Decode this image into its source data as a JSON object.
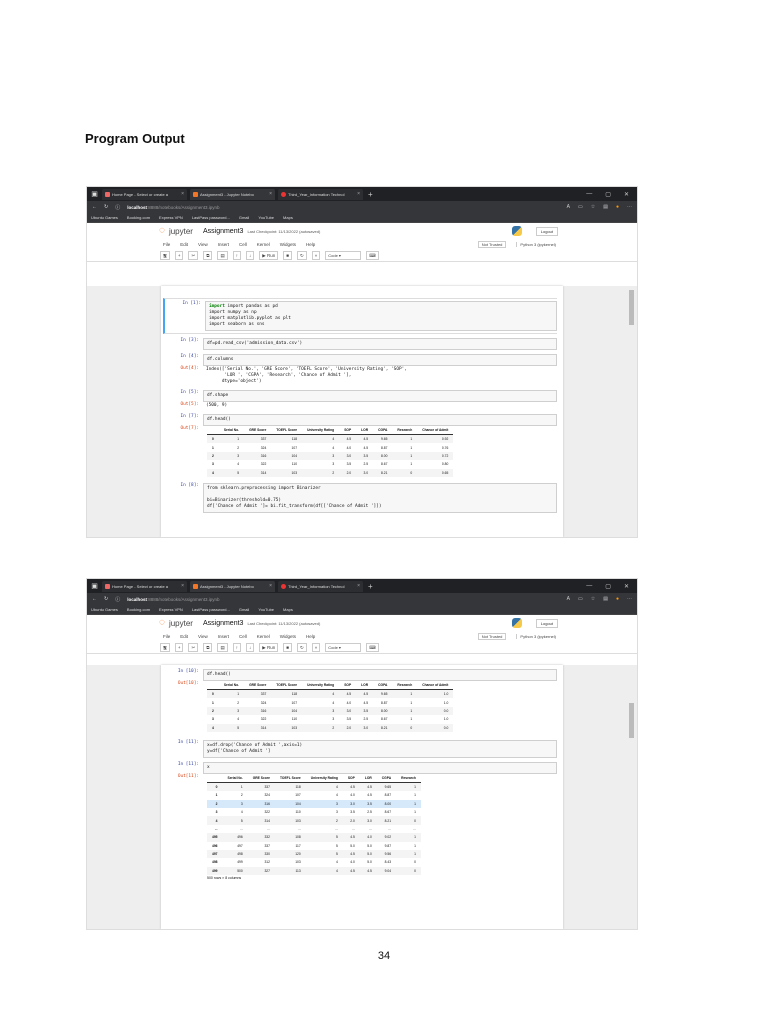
{
  "page": {
    "heading": "Program  Output",
    "page_number": "34"
  },
  "browser": {
    "tabs": [
      {
        "label": "Home Page - Select or create a"
      },
      {
        "label": "Assignment3 - Jupyter Notebo"
      },
      {
        "label": "Third_Year_Information Technol"
      }
    ],
    "url_host": "localhost",
    "url_path": ":8888/notebooks/Assignment3.ipynb",
    "bookmarks": [
      "Ubuntu Games",
      "Booking.com",
      "Express VPN",
      "LastPass password...",
      "Gmail",
      "YouTube",
      "Maps"
    ]
  },
  "jupyter": {
    "brand": "jupyter",
    "notebook_name": "Assignment3",
    "checkpoint": "Last Checkpoint: 11/13/2022  (autosaved)",
    "logout": "Logout",
    "menu": [
      "File",
      "Edit",
      "View",
      "Insert",
      "Cell",
      "Kernel",
      "Widgets",
      "Help"
    ],
    "not_trusted": "Not Trusted",
    "kernel": "Python 3 (ipykernel)",
    "cell_type": "Code",
    "toolbar_run": "Run"
  },
  "screen1": {
    "cells": [
      {
        "prompt": "In [1]:",
        "lines": [
          "import pandas as pd",
          "import numpy as np",
          "import matplotlib.pyplot as plt",
          "import seaborn as sns"
        ]
      },
      {
        "prompt": "In [3]:",
        "lines": [
          "df=pd.read_csv('admission_data.csv')"
        ]
      },
      {
        "prompt": "In [4]:",
        "lines": [
          "df.columns"
        ]
      },
      {
        "prompt": "Out[4]:",
        "lines": [
          "Index(['Serial No.', 'GRE Score', 'TOEFL Score', 'University Rating', 'SOP',",
          "       'LOR ', 'CGPA', 'Research', 'Chance of Admit '],",
          "      dtype='object')"
        ]
      },
      {
        "prompt": "In [5]:",
        "lines": [
          "df.shape"
        ]
      },
      {
        "prompt": "Out[5]:",
        "lines": [
          "(500, 9)"
        ]
      },
      {
        "prompt": "In [7]:",
        "lines": [
          "df.head()"
        ]
      },
      {
        "prompt": "Out[7]:"
      },
      {
        "prompt": "In [8]:",
        "lines": [
          "from sklearn.preprocessing import Binarizer",
          "",
          "bi=Binarizer(threshold=0.75)",
          "df['Chance of Admit ']= bi.fit_transform(df[['Chance of Admit ']])"
        ]
      }
    ],
    "head_table": {
      "columns": [
        "",
        "Serial No.",
        "GRE Score",
        "TOEFL Score",
        "University Rating",
        "SOP",
        "LOR",
        "CGPA",
        "Research",
        "Chance of Admit"
      ],
      "rows": [
        [
          "0",
          "1",
          "337",
          "118",
          "4",
          "4.5",
          "4.5",
          "9.65",
          "1",
          "0.92"
        ],
        [
          "1",
          "2",
          "324",
          "107",
          "4",
          "4.0",
          "4.5",
          "8.87",
          "1",
          "0.76"
        ],
        [
          "2",
          "3",
          "316",
          "104",
          "3",
          "3.0",
          "3.5",
          "8.00",
          "1",
          "0.72"
        ],
        [
          "3",
          "4",
          "322",
          "110",
          "3",
          "3.5",
          "2.5",
          "8.67",
          "1",
          "0.80"
        ],
        [
          "4",
          "5",
          "314",
          "103",
          "2",
          "2.0",
          "3.0",
          "8.21",
          "0",
          "0.65"
        ]
      ]
    }
  },
  "screen2": {
    "cells": [
      {
        "prompt": "In [10]:",
        "lines": [
          "df.head()"
        ]
      },
      {
        "prompt": "Out[10]:"
      },
      {
        "prompt": "In [11]:",
        "lines": [
          "x=df.drop('Chance of Admit ',axis=1)",
          "y=df['Chance of Admit ']"
        ]
      },
      {
        "prompt": "In [11]:",
        "lines": [
          "x"
        ]
      },
      {
        "prompt": "Out[11]:"
      }
    ],
    "head_table": {
      "columns": [
        "",
        "Serial No.",
        "GRE Score",
        "TOEFL Score",
        "University Rating",
        "SOP",
        "LOR",
        "CGPA",
        "Research",
        "Chance of Admit"
      ],
      "rows": [
        [
          "0",
          "1",
          "337",
          "118",
          "4",
          "4.5",
          "4.5",
          "9.65",
          "1",
          "1.0"
        ],
        [
          "1",
          "2",
          "324",
          "107",
          "4",
          "4.0",
          "4.5",
          "8.87",
          "1",
          "1.0"
        ],
        [
          "2",
          "3",
          "316",
          "104",
          "3",
          "3.0",
          "3.5",
          "8.00",
          "1",
          "0.0"
        ],
        [
          "3",
          "4",
          "322",
          "110",
          "3",
          "3.5",
          "2.5",
          "8.67",
          "1",
          "1.0"
        ],
        [
          "4",
          "5",
          "314",
          "103",
          "2",
          "2.0",
          "3.0",
          "8.21",
          "0",
          "0.0"
        ]
      ]
    },
    "x_table": {
      "columns": [
        "",
        "Serial No.",
        "GRE Score",
        "TOEFL Score",
        "University Rating",
        "SOP",
        "LOR",
        "CGPA",
        "Research"
      ],
      "rows": [
        [
          "0",
          "1",
          "337",
          "118",
          "4",
          "4.5",
          "4.5",
          "9.65",
          "1"
        ],
        [
          "1",
          "2",
          "324",
          "107",
          "4",
          "4.0",
          "4.5",
          "8.87",
          "1"
        ],
        [
          "2",
          "3",
          "316",
          "104",
          "3",
          "3.0",
          "3.5",
          "8.00",
          "1"
        ],
        [
          "3",
          "4",
          "322",
          "110",
          "3",
          "3.5",
          "2.5",
          "8.67",
          "1"
        ],
        [
          "4",
          "5",
          "314",
          "103",
          "2",
          "2.0",
          "3.0",
          "8.21",
          "0"
        ],
        [
          "...",
          "...",
          "...",
          "...",
          "...",
          "...",
          "...",
          "...",
          "..."
        ],
        [
          "495",
          "496",
          "332",
          "108",
          "5",
          "4.5",
          "4.0",
          "9.02",
          "1"
        ],
        [
          "496",
          "497",
          "337",
          "117",
          "5",
          "5.0",
          "5.0",
          "9.87",
          "1"
        ],
        [
          "497",
          "498",
          "330",
          "120",
          "5",
          "4.5",
          "5.0",
          "9.56",
          "1"
        ],
        [
          "498",
          "499",
          "312",
          "103",
          "4",
          "4.0",
          "5.0",
          "8.43",
          "0"
        ],
        [
          "499",
          "500",
          "327",
          "113",
          "4",
          "4.5",
          "4.5",
          "9.04",
          "0"
        ]
      ],
      "note": "500 rows × 8 columns"
    }
  }
}
